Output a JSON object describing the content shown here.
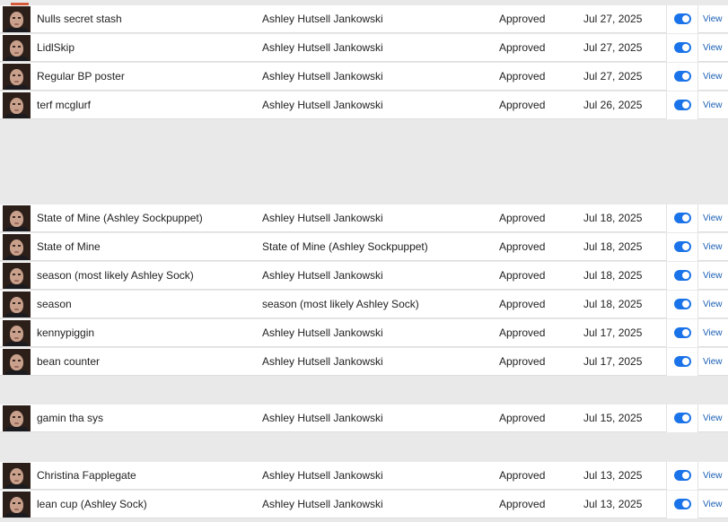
{
  "colors": {
    "toggle_on": "#1a73e8",
    "link": "#1a5fb4",
    "background": "#e9e9e9"
  },
  "rows": [
    {
      "name": "Nulls secret stash",
      "by": "Ashley Hutsell Jankowski",
      "status": "Approved",
      "date": "Jul 27, 2025",
      "enabled": true,
      "action": "View"
    },
    {
      "name": "LidlSkip",
      "by": "Ashley Hutsell Jankowski",
      "status": "Approved",
      "date": "Jul 27, 2025",
      "enabled": true,
      "action": "View"
    },
    {
      "name": "Regular BP poster",
      "by": "Ashley Hutsell Jankowski",
      "status": "Approved",
      "date": "Jul 27, 2025",
      "enabled": true,
      "action": "View"
    },
    {
      "name": "terf mcglurf",
      "by": "Ashley Hutsell Jankowski",
      "status": "Approved",
      "date": "Jul 26, 2025",
      "enabled": true,
      "action": "View"
    },
    {
      "name": "State of Mine (Ashley Sockpuppet)",
      "by": "Ashley Hutsell Jankowski",
      "status": "Approved",
      "date": "Jul 18, 2025",
      "enabled": true,
      "action": "View"
    },
    {
      "name": "State of Mine",
      "by": "State of Mine (Ashley Sockpuppet)",
      "status": "Approved",
      "date": "Jul 18, 2025",
      "enabled": true,
      "action": "View"
    },
    {
      "name": "season (most likely Ashley Sock)",
      "by": "Ashley Hutsell Jankowski",
      "status": "Approved",
      "date": "Jul 18, 2025",
      "enabled": true,
      "action": "View"
    },
    {
      "name": "season",
      "by": "season (most likely Ashley Sock)",
      "status": "Approved",
      "date": "Jul 18, 2025",
      "enabled": true,
      "action": "View"
    },
    {
      "name": "kennypiggin",
      "by": "Ashley Hutsell Jankowski",
      "status": "Approved",
      "date": "Jul 17, 2025",
      "enabled": true,
      "action": "View"
    },
    {
      "name": "bean counter",
      "by": "Ashley Hutsell Jankowski",
      "status": "Approved",
      "date": "Jul 17, 2025",
      "enabled": true,
      "action": "View"
    },
    {
      "name": "gamin tha sys",
      "by": "Ashley Hutsell Jankowski",
      "status": "Approved",
      "date": "Jul 15, 2025",
      "enabled": true,
      "action": "View"
    },
    {
      "name": "Christina Fapplegate",
      "by": "Ashley Hutsell Jankowski",
      "status": "Approved",
      "date": "Jul 13, 2025",
      "enabled": true,
      "action": "View"
    },
    {
      "name": "lean cup (Ashley Sock)",
      "by": "Ashley Hutsell Jankowski",
      "status": "Approved",
      "date": "Jul 13, 2025",
      "enabled": true,
      "action": "View"
    }
  ]
}
